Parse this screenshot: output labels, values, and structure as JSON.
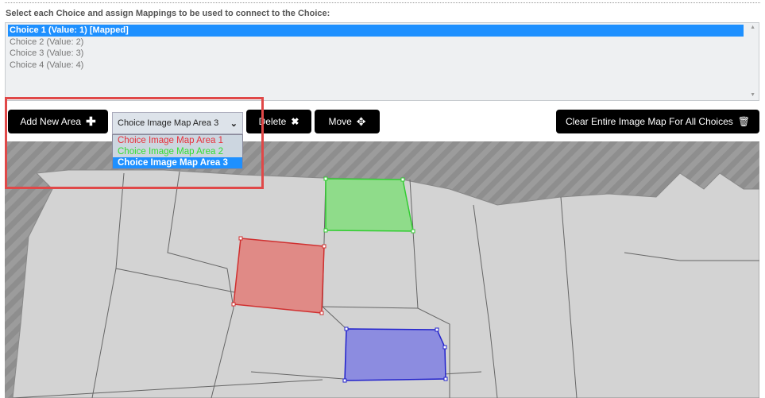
{
  "instruction": "Select each Choice and assign Mappings to be used to connect to the Choice:",
  "choices": [
    {
      "label": "Choice 1 (Value: 1) [Mapped]",
      "selected": true
    },
    {
      "label": "Choice 2 (Value: 2)",
      "selected": false
    },
    {
      "label": "Choice 3 (Value: 3)",
      "selected": false
    },
    {
      "label": "Choice 4 (Value: 4)",
      "selected": false
    }
  ],
  "toolbar": {
    "add_label": "Add New Area",
    "add_icon": "plus-icon",
    "select_value": "Choice Image Map Area 3",
    "delete_label": "Delete",
    "delete_icon": "x-icon",
    "move_label": "Move",
    "move_icon": "move-arrows-icon",
    "clear_label": "Clear Entire Image Map For All Choices",
    "clear_icon": "trash-icon"
  },
  "area_options": [
    {
      "label": "Choice Image Map Area 1",
      "color": "#e8303a"
    },
    {
      "label": "Choice Image Map Area 2",
      "color": "#33dd33"
    },
    {
      "label": "Choice Image Map Area 3",
      "color": "#ffffff"
    }
  ],
  "areas": [
    {
      "name": "Choice Image Map Area 1",
      "fill": "#e08a86",
      "stroke": "#d03030"
    },
    {
      "name": "Choice Image Map Area 2",
      "fill": "#8fdc8a",
      "stroke": "#33cc33"
    },
    {
      "name": "Choice Image Map Area 3",
      "fill": "#8c8ce0",
      "stroke": "#2222cc"
    }
  ],
  "colors": {
    "accent": "#1e90ff",
    "highlight": "#e04848"
  }
}
